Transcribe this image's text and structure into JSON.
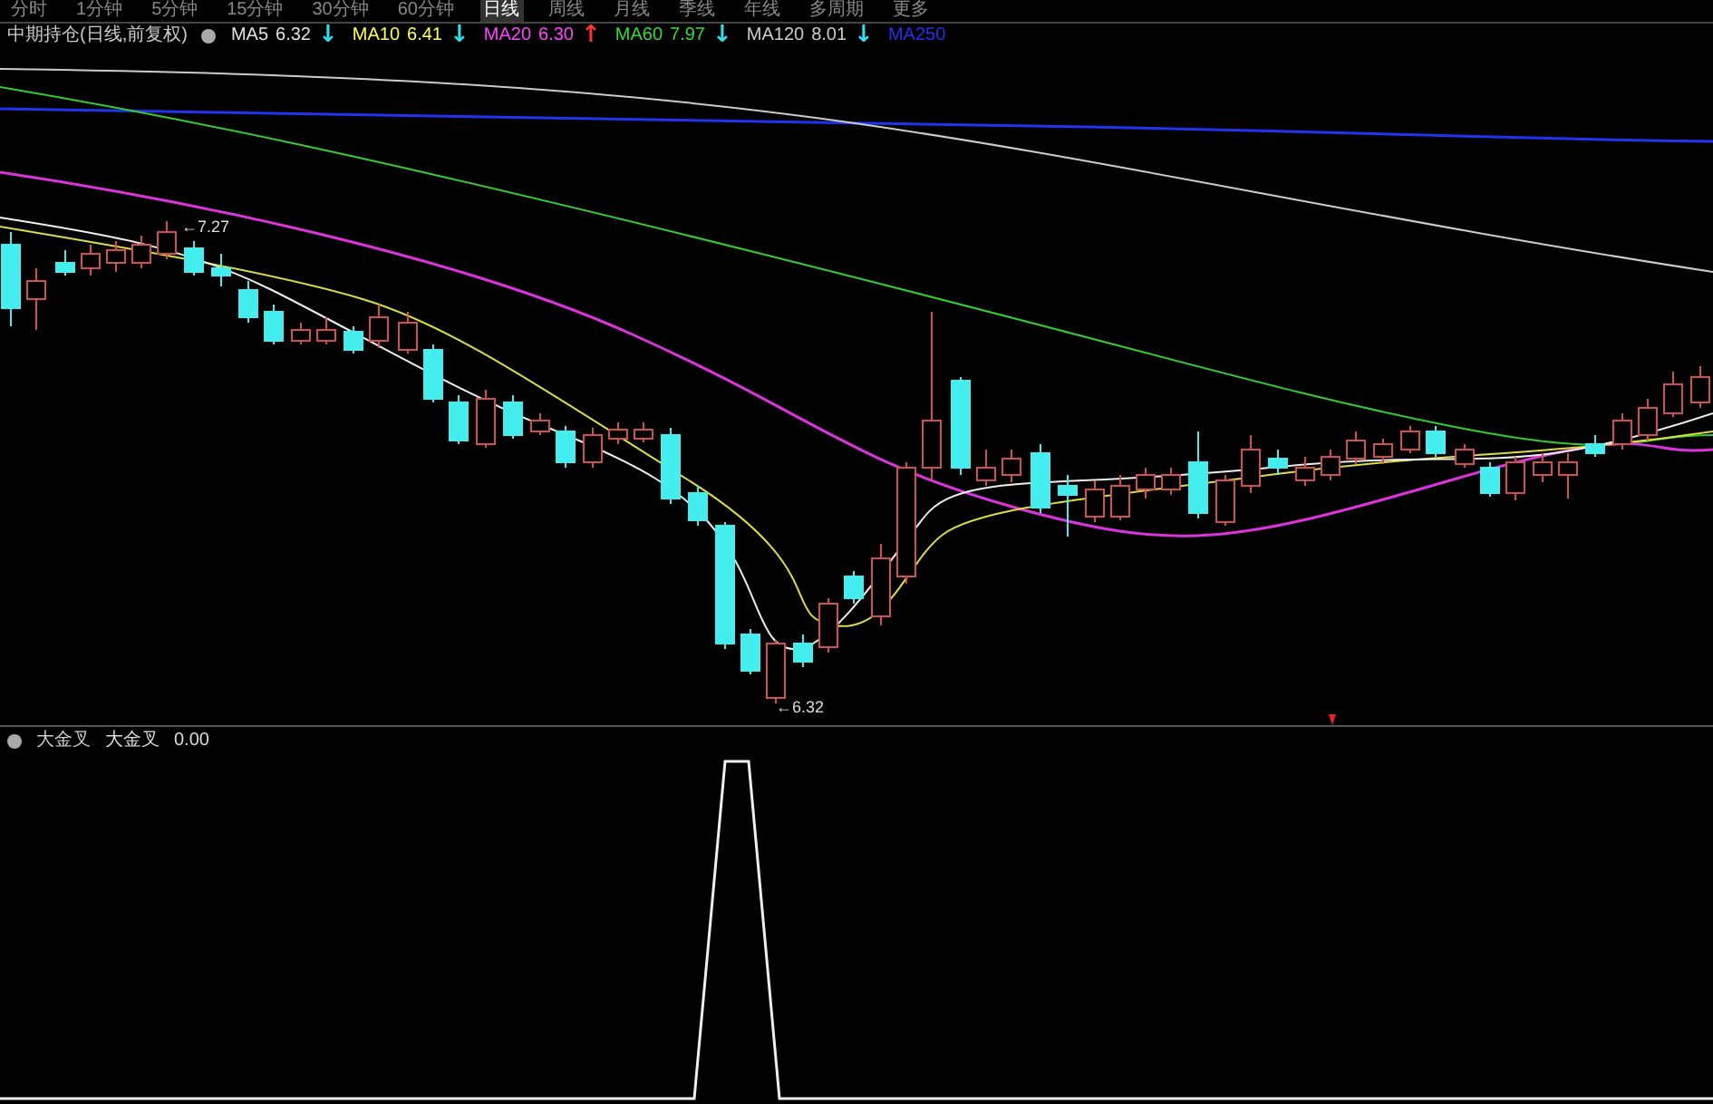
{
  "period_tabs": [
    {
      "label": "分时",
      "selected": false
    },
    {
      "label": "1分钟",
      "selected": false
    },
    {
      "label": "5分钟",
      "selected": false
    },
    {
      "label": "15分钟",
      "selected": false
    },
    {
      "label": "30分钟",
      "selected": false
    },
    {
      "label": "60分钟",
      "selected": false
    },
    {
      "label": "日线",
      "selected": true
    },
    {
      "label": "周线",
      "selected": false
    },
    {
      "label": "月线",
      "selected": false
    },
    {
      "label": "季线",
      "selected": false
    },
    {
      "label": "年线",
      "selected": false
    },
    {
      "label": "多周期",
      "selected": false
    },
    {
      "label": "更多",
      "selected": false
    }
  ],
  "main_chart": {
    "title": "中期持仓(日线,前复权)",
    "moving_averages": [
      {
        "label": "MA5",
        "value": "6.32",
        "arrow": {
          "symbol": "↓",
          "color": "#33ddee"
        },
        "color": "#e0e0e0"
      },
      {
        "label": "MA10",
        "value": "6.41",
        "arrow": {
          "symbol": "↓",
          "color": "#33ddee"
        },
        "color": "#ffff55"
      },
      {
        "label": "MA20",
        "value": "6.30",
        "arrow": {
          "symbol": "↑",
          "color": "#ff3333"
        },
        "color": "#ff44ff"
      },
      {
        "label": "MA60",
        "value": "7.97",
        "arrow": {
          "symbol": "↓",
          "color": "#33ddee"
        },
        "color": "#33dd33"
      },
      {
        "label": "MA120",
        "value": "8.01",
        "arrow": {
          "symbol": "↓",
          "color": "#33ddee"
        },
        "color": "#cccccc"
      },
      {
        "label": "MA250",
        "color": "#2233ee"
      }
    ],
    "high_label": "←7.27",
    "low_label": "←6.32"
  },
  "indicator": {
    "name": "大金叉",
    "series_label": "大金叉",
    "value": "0.00"
  }
}
